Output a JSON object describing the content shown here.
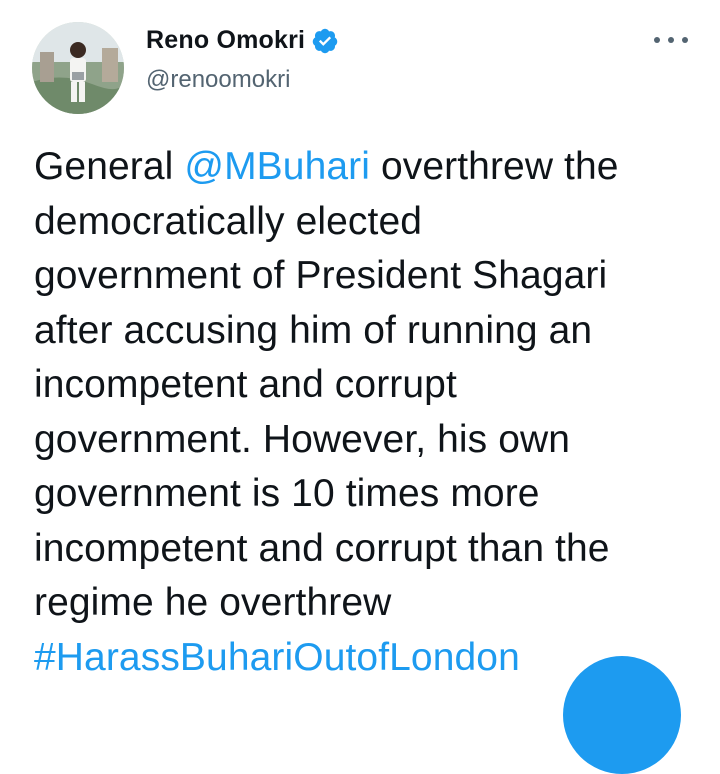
{
  "author": {
    "display_name": "Reno Omokri",
    "handle": "@renoomokri",
    "verified": true,
    "avatar_icon": "profile-photo"
  },
  "tweet": {
    "lines": [
      {
        "pre": "General ",
        "mention": "@MBuhari",
        "post": " overthrew the"
      },
      {
        "text": "democratically elected"
      },
      {
        "text": "government of President Shagari"
      },
      {
        "text": "after accusing him of running an"
      },
      {
        "text": "incompetent and corrupt"
      },
      {
        "text": "government. However, his own"
      },
      {
        "text": "government is 10 times more"
      },
      {
        "text": "incompetent and corrupt than the"
      },
      {
        "text": "regime he overthrew"
      }
    ],
    "hashtag": "#HarassBuhariOutofLondon"
  },
  "icons": {
    "verified": "verified-badge-icon",
    "more": "more-options-icon",
    "compose": "compose-fab"
  },
  "colors": {
    "link": "#1d9bf0",
    "text": "#0f1419",
    "secondary": "#536471"
  }
}
